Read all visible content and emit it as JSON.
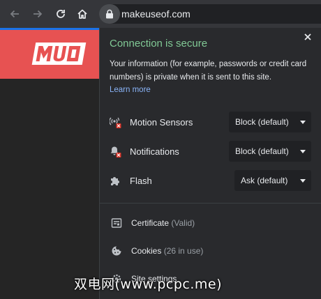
{
  "toolbar": {
    "url": "makeuseof.com",
    "icons": [
      "back-arrow-icon",
      "forward-arrow-icon",
      "reload-icon",
      "home-icon",
      "lock-icon"
    ]
  },
  "site": {
    "logo_text": "MUO",
    "brand_color": "#e75252"
  },
  "popup": {
    "title": "Connection is secure",
    "title_color": "#81c995",
    "description": "Your information (for example, passwords or credit card numbers) is private when it is sent to this site.",
    "learn_more": "Learn more",
    "link_color": "#8ab4f8",
    "permissions": [
      {
        "label": "Motion Sensors",
        "value": "Block (default)",
        "icon": "motion-sensor-blocked-icon"
      },
      {
        "label": "Notifications",
        "value": "Block (default)",
        "icon": "notification-blocked-icon"
      },
      {
        "label": "Flash",
        "value": "Ask (default)",
        "icon": "puzzle-icon"
      }
    ],
    "certificate": {
      "label": "Certificate",
      "sub": "(Valid)"
    },
    "cookies": {
      "label": "Cookies",
      "sub": "(26 in use)"
    },
    "site_settings": {
      "label": "Site settings"
    }
  },
  "watermark": "双电网(www.pcpc.me)"
}
